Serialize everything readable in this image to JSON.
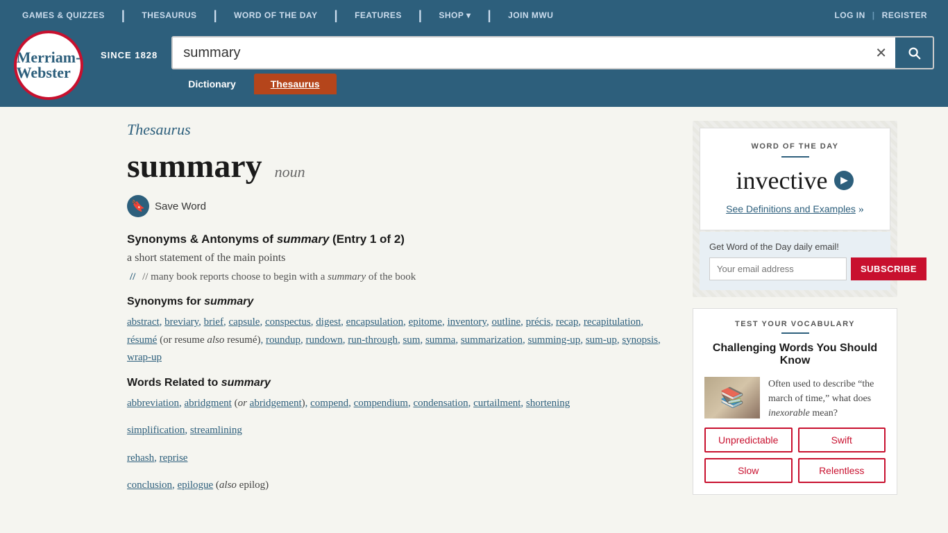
{
  "topnav": {
    "links": [
      "GAMES & QUIZZES",
      "THESAURUS",
      "WORD OF THE DAY",
      "FEATURES",
      "SHOP ▾",
      "JOIN MWU"
    ],
    "right_links": [
      "LOG IN",
      "REGISTER"
    ]
  },
  "header": {
    "logo_line1": "Merriam-",
    "logo_line2": "Webster",
    "since": "SINCE 1828",
    "search_value": "summary",
    "search_placeholder": "summary",
    "tab_dictionary": "Dictionary",
    "tab_thesaurus": "Thesaurus"
  },
  "thesaurus_label": "Thesaurus",
  "entry": {
    "word": "summary",
    "pos": "noun",
    "save_word": "Save Word",
    "section_title": "Synonyms & Antonyms of",
    "section_word": "summary",
    "entry_info": "(Entry 1 of 2)",
    "definition": "a short statement of the main points",
    "example_prefix": "// many book reports choose to begin with a",
    "example_word": "summary",
    "example_suffix": "of the book",
    "synonyms_heading_prefix": "Synonyms for",
    "synonyms_heading_word": "summary",
    "synonyms": "abstract, breviary, brief, capsule, conspectus, digest, encapsulation, epitome, inventory, outline, précis, recap, recapitulation, résumé (or resume also resumé), roundup, rundown, run-through, sum, summa, summarization, summing-up, sum-up, synopsis, wrap-up",
    "related_heading_prefix": "Words Related to",
    "related_heading_word": "summary",
    "related_words_1": "abbreviation, abridgment (or abridgement), compend, compendium, condensation, curtailment, shortening",
    "related_words_2": "simplification, streamlining",
    "related_words_3": "rehash, reprise",
    "related_words_4": "conclusion, epilogue (also epilog)"
  },
  "sidebar": {
    "wotd_label": "WORD OF THE DAY",
    "wotd_word": "invective",
    "wotd_link": "See Definitions and Examples",
    "email_label": "Get Word of the Day daily email!",
    "email_placeholder": "Your email address",
    "subscribe_btn": "SUBSCRIBE",
    "vocab_heading": "TEST YOUR VOCABULARY",
    "vocab_title": "Challenging Words You Should Know",
    "vocab_desc_prefix": "Often used to describe “the march of time,” what does",
    "vocab_desc_word": "inexorable",
    "vocab_desc_suffix": "mean?",
    "vocab_choices": [
      "Unpredictable",
      "Swift",
      "Slow",
      "Relentless"
    ]
  }
}
